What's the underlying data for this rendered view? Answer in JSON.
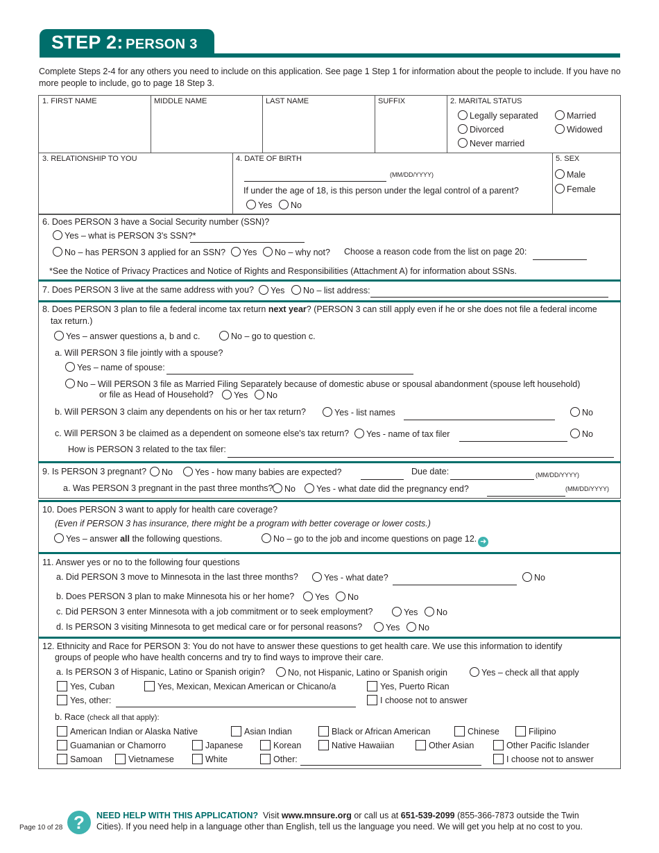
{
  "header": {
    "step": "STEP 2:",
    "person": "PERSON 3"
  },
  "intro": "Complete Steps 2-4 for any others you need to include on this application. See page 1 Step 1 for information about the people to include. If you have no more people to include, go to page 18 Step 3.",
  "section1": {
    "first_name": "1. FIRST NAME",
    "middle_name": "MIDDLE NAME",
    "last_name": "LAST NAME",
    "suffix": "SUFFIX",
    "marital_status": {
      "label": "2. MARITAL STATUS",
      "options": [
        "Legally separated",
        "Married",
        "Divorced",
        "Widowed",
        "Never married"
      ]
    },
    "relationship": "3. RELATIONSHIP TO YOU",
    "dob": {
      "label": "4. DATE OF BIRTH",
      "format": "(MM/DD/YYYY)",
      "question": "If under the age of 18, is this person under the legal control of a parent?",
      "yes": "Yes",
      "no": "No"
    },
    "sex": {
      "label": "5. SEX",
      "male": "Male",
      "female": "Female"
    }
  },
  "q6": {
    "question": "6. Does PERSON 3 have a Social Security number (SSN)?",
    "yes": "Yes – what is PERSON 3's SSN?*",
    "no": "No – has PERSON 3 applied for an SSN?",
    "applied_yes": "Yes",
    "applied_no": "No – why not?",
    "reason": "Choose a reason code from the list on page 20:",
    "note": "*See the Notice of Privacy Practices and Notice of Rights and Responsibilities (Attachment A) for information about SSNs."
  },
  "q7": {
    "question": "7. Does PERSON 3 live at the same address with you?",
    "yes": "Yes",
    "no": "No – list address:"
  },
  "q8": {
    "question_pre": "8. Does PERSON 3 plan to file a federal income tax return ",
    "question_bold": "next year",
    "question_post": "? (PERSON 3 can still apply even if he or she does not file a federal income",
    "question_line2": "tax return.)",
    "yes": "Yes – answer questions a, b and c.",
    "no": "No – go to question c.",
    "a": {
      "question": "a. Will PERSON 3 file jointly with a spouse?",
      "yes": "Yes – name of spouse:",
      "no_line1": "No – Will PERSON 3 file as Married Filing Separately because of domestic abuse or spousal abandonment (spouse left household)",
      "no_line2": "or file as Head of Household?",
      "no_yes": "Yes",
      "no_no": "No"
    },
    "b": {
      "question": "b. Will PERSON 3 claim any dependents on his or her tax return?",
      "yes": "Yes - list names",
      "no": "No"
    },
    "c": {
      "question": "c. Will PERSON 3 be claimed as a dependent on someone else's tax return?",
      "yes": "Yes - name of tax filer",
      "no": "No",
      "related": "How is PERSON 3 related to the tax filer:"
    }
  },
  "q9": {
    "question": "9. Is PERSON 3 pregnant?",
    "no": "No",
    "yes": "Yes -  how many babies are expected?",
    "due": "Due date:",
    "format": "(MM/DD/YYYY)",
    "a": {
      "question": "a. Was PERSON 3 pregnant in the past three months?",
      "no": "No",
      "yes": "Yes - what date did the pregnancy end?",
      "format": "(MM/DD/YYYY)"
    }
  },
  "q10": {
    "question": "10. Does PERSON 3 want to apply for health care coverage?",
    "note": "(Even if PERSON 3 has insurance, there might be a program with better coverage or lower costs.)",
    "yes_pre": "Yes – answer ",
    "yes_bold": "all",
    "yes_post": " the following questions.",
    "no": "No – go to the job and income questions on page 12."
  },
  "q11": {
    "question": "11. Answer yes or no to the following four questions",
    "a": {
      "question": "a. Did PERSON 3 move to Minnesota in the last three months?",
      "yes": "Yes - what date?",
      "no": "No"
    },
    "b": {
      "question": "b. Does PERSON 3 plan to make Minnesota his or her home?",
      "yes": "Yes",
      "no": "No"
    },
    "c": {
      "question": "c. Did PERSON 3 enter Minnesota with a job commitment or to seek employment?",
      "yes": "Yes",
      "no": "No"
    },
    "d": {
      "question": "d. Is PERSON 3 visiting Minnesota to get medical care or for personal reasons?",
      "yes": "Yes",
      "no": "No"
    }
  },
  "q12": {
    "line1": "12. Ethnicity and Race for PERSON 3: You do not have to answer these questions to get health care. We use this information to identify",
    "line2": "groups of people who have health concerns and try to find ways to improve their care.",
    "a": {
      "question": "a.  Is PERSON 3 of Hispanic, Latino or Spanish origin?",
      "no": "No, not Hispanic, Latino or Spanish origin",
      "yes": "Yes – check all that apply",
      "options": [
        "Yes, Cuban",
        "Yes, Mexican, Mexican American or Chicano/a",
        "Yes, Puerto Rican",
        "Yes, other:",
        "I choose not to answer"
      ]
    },
    "b": {
      "label": "b. Race",
      "hint": "(check all that apply):",
      "options": [
        "American Indian or Alaska Native",
        "Asian Indian",
        "Black or African American",
        "Chinese",
        "Filipino",
        "Guamanian or Chamorro",
        "Japanese",
        "Korean",
        "Native Hawaiian",
        "Other Asian",
        "Other Pacific Islander",
        "Samoan",
        "Vietnamese",
        "White",
        "Other:",
        "I choose not to answer"
      ]
    }
  },
  "footer": {
    "page": "Page 10 of 28",
    "help_heading": "NEED HELP WITH THIS APPLICATION?",
    "visit": "  Visit ",
    "url": "www.mnsure.org",
    "call": " or call us at ",
    "phone": "651-539-2099",
    "line1_end": " (855-366-7873 outside the Twin",
    "line2": "Cities). If you need help in a language other than English, tell us the language you need. We will get you help at no cost to you."
  },
  "colors": {
    "brand_teal": "#006e6b",
    "help_teal": "#3fb3b0"
  }
}
